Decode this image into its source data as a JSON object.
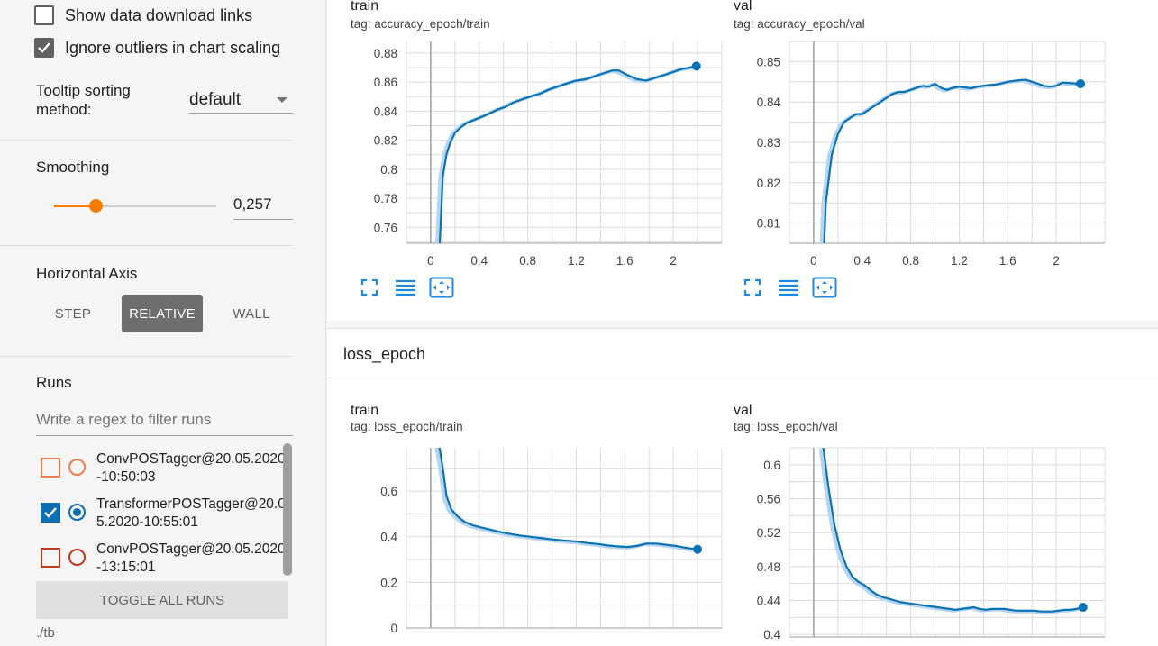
{
  "sidebar": {
    "show_download_links": {
      "label": "Show data download links",
      "checked": false
    },
    "ignore_outliers": {
      "label": "Ignore outliers in chart scaling",
      "checked": true
    },
    "tooltip_sorting": {
      "label_line1": "Tooltip sorting",
      "label_line2": "method:",
      "value": "default"
    },
    "smoothing": {
      "label": "Smoothing",
      "value": "0,257",
      "level": 0.257
    },
    "horizontal_axis": {
      "label": "Horizontal Axis",
      "options": [
        "STEP",
        "RELATIVE",
        "WALL"
      ],
      "selected": "RELATIVE"
    },
    "runs": {
      "label": "Runs",
      "filter_placeholder": "Write a regex to filter runs",
      "items": [
        {
          "name": "ConvPOSTagger@20.05.2020-10:50:03",
          "color": "#ef7c4f",
          "checked": false,
          "selected": false
        },
        {
          "name": "TransformerPOSTagger@20.05.2020-10:55:01",
          "color": "#0d6eb5",
          "checked": true,
          "selected": true
        },
        {
          "name": "ConvPOSTagger@20.05.2020-13:15:01",
          "color": "#c0391d",
          "checked": false,
          "selected": false
        }
      ],
      "toggle_all_label": "TOGGLE ALL RUNS",
      "logdir": "./tb"
    }
  },
  "main": {
    "group_title": "loss_epoch",
    "line_color": "#0b72b8",
    "smooth_color": "#b7d5ec"
  },
  "chart_data": [
    {
      "type": "line",
      "title": "train",
      "tag": "tag: accuracy_epoch/train",
      "xticks": [
        0,
        0.4,
        0.8,
        1.2,
        1.6,
        2
      ],
      "xtick_labels": [
        "0",
        "0.4",
        "0.8",
        "1.2",
        "1.6",
        "2"
      ],
      "yticks": [
        0.76,
        0.78,
        0.8,
        0.82,
        0.84,
        0.86,
        0.88
      ],
      "ytick_labels": [
        "0.76",
        "0.78",
        "0.8",
        "0.82",
        "0.84",
        "0.86",
        "0.88"
      ],
      "xlim": [
        -0.2,
        2.4
      ],
      "ylim": [
        0.749,
        0.888
      ],
      "x": [
        0.07,
        0.1,
        0.13,
        0.16,
        0.2,
        0.25,
        0.3,
        0.36,
        0.42,
        0.5,
        0.55,
        0.62,
        0.68,
        0.75,
        0.82,
        0.9,
        0.98,
        1.05,
        1.12,
        1.2,
        1.28,
        1.35,
        1.42,
        1.5,
        1.55,
        1.62,
        1.7,
        1.78,
        1.85,
        1.93,
        2.0,
        2.07,
        2.14,
        2.19
      ],
      "y": [
        0.74,
        0.795,
        0.81,
        0.818,
        0.825,
        0.829,
        0.832,
        0.834,
        0.836,
        0.839,
        0.841,
        0.843,
        0.846,
        0.848,
        0.85,
        0.852,
        0.855,
        0.857,
        0.859,
        0.861,
        0.862,
        0.864,
        0.866,
        0.868,
        0.868,
        0.865,
        0.862,
        0.861,
        0.863,
        0.865,
        0.867,
        0.869,
        0.87,
        0.871
      ]
    },
    {
      "type": "line",
      "title": "val",
      "tag": "tag: accuracy_epoch/val",
      "xticks": [
        0,
        0.4,
        0.8,
        1.2,
        1.6,
        2
      ],
      "xtick_labels": [
        "0",
        "0.4",
        "0.8",
        "1.2",
        "1.6",
        "2"
      ],
      "yticks": [
        0.81,
        0.82,
        0.83,
        0.84,
        0.85
      ],
      "ytick_labels": [
        "0.81",
        "0.82",
        "0.83",
        "0.84",
        "0.85"
      ],
      "xlim": [
        -0.2,
        2.4
      ],
      "ylim": [
        0.805,
        0.855
      ],
      "x": [
        0.08,
        0.1,
        0.15,
        0.2,
        0.25,
        0.3,
        0.35,
        0.4,
        0.45,
        0.5,
        0.55,
        0.6,
        0.65,
        0.7,
        0.75,
        0.8,
        0.85,
        0.9,
        0.95,
        1.0,
        1.05,
        1.1,
        1.15,
        1.2,
        1.25,
        1.3,
        1.35,
        1.4,
        1.45,
        1.5,
        1.55,
        1.6,
        1.65,
        1.7,
        1.75,
        1.8,
        1.85,
        1.9,
        1.95,
        2.0,
        2.05,
        2.1,
        2.15,
        2.2
      ],
      "y": [
        0.8,
        0.815,
        0.827,
        0.832,
        0.835,
        0.836,
        0.837,
        0.837,
        0.838,
        0.839,
        0.84,
        0.841,
        0.842,
        0.8425,
        0.8425,
        0.843,
        0.8435,
        0.844,
        0.8438,
        0.8445,
        0.8435,
        0.843,
        0.8435,
        0.8438,
        0.8436,
        0.8434,
        0.8438,
        0.844,
        0.8442,
        0.8443,
        0.8446,
        0.845,
        0.8452,
        0.8454,
        0.8455,
        0.845,
        0.8445,
        0.844,
        0.8438,
        0.844,
        0.8448,
        0.8447,
        0.8446,
        0.8445
      ]
    },
    {
      "type": "line",
      "title": "train",
      "tag": "tag: loss_epoch/train",
      "xticks": [
        0,
        0.4,
        0.8,
        1.2,
        1.6,
        2
      ],
      "xtick_labels": [],
      "yticks": [
        0,
        0.2,
        0.4,
        0.6
      ],
      "ytick_labels": [
        "0",
        "0.2",
        "0.4",
        "0.6"
      ],
      "xlim": [
        -0.2,
        2.4
      ],
      "ylim": [
        0,
        0.79
      ],
      "x": [
        0.07,
        0.1,
        0.13,
        0.17,
        0.22,
        0.28,
        0.35,
        0.42,
        0.5,
        0.58,
        0.66,
        0.74,
        0.82,
        0.9,
        0.98,
        1.06,
        1.14,
        1.22,
        1.3,
        1.38,
        1.46,
        1.54,
        1.62,
        1.7,
        1.78,
        1.86,
        1.94,
        2.02,
        2.1,
        2.2
      ],
      "y": [
        0.8,
        0.7,
        0.58,
        0.52,
        0.49,
        0.465,
        0.45,
        0.44,
        0.43,
        0.42,
        0.412,
        0.405,
        0.4,
        0.395,
        0.39,
        0.385,
        0.382,
        0.378,
        0.372,
        0.368,
        0.362,
        0.358,
        0.355,
        0.36,
        0.37,
        0.37,
        0.365,
        0.36,
        0.352,
        0.345
      ]
    },
    {
      "type": "line",
      "title": "val",
      "tag": "tag: loss_epoch/val",
      "xticks": [
        0,
        0.4,
        0.8,
        1.2,
        1.6,
        2
      ],
      "xtick_labels": [],
      "yticks": [
        0.4,
        0.44,
        0.48,
        0.52,
        0.56,
        0.6
      ],
      "ytick_labels": [
        "0.4",
        "0.44",
        "0.48",
        "0.52",
        "0.56",
        "0.6"
      ],
      "xlim": [
        -0.2,
        2.4
      ],
      "ylim": [
        0.397,
        0.62
      ],
      "x": [
        0.08,
        0.12,
        0.17,
        0.22,
        0.27,
        0.32,
        0.37,
        0.42,
        0.47,
        0.52,
        0.57,
        0.62,
        0.67,
        0.72,
        0.77,
        0.82,
        0.87,
        0.92,
        0.97,
        1.02,
        1.07,
        1.12,
        1.17,
        1.22,
        1.27,
        1.32,
        1.37,
        1.42,
        1.47,
        1.52,
        1.57,
        1.62,
        1.67,
        1.72,
        1.77,
        1.82,
        1.87,
        1.92,
        1.97,
        2.02,
        2.07,
        2.12,
        2.17,
        2.22
      ],
      "y": [
        0.62,
        0.575,
        0.53,
        0.5,
        0.48,
        0.468,
        0.462,
        0.458,
        0.452,
        0.447,
        0.444,
        0.442,
        0.44,
        0.438,
        0.437,
        0.436,
        0.435,
        0.434,
        0.433,
        0.432,
        0.431,
        0.43,
        0.429,
        0.43,
        0.431,
        0.432,
        0.43,
        0.429,
        0.43,
        0.43,
        0.43,
        0.429,
        0.428,
        0.428,
        0.428,
        0.428,
        0.427,
        0.427,
        0.427,
        0.428,
        0.429,
        0.429,
        0.43,
        0.432
      ]
    }
  ]
}
